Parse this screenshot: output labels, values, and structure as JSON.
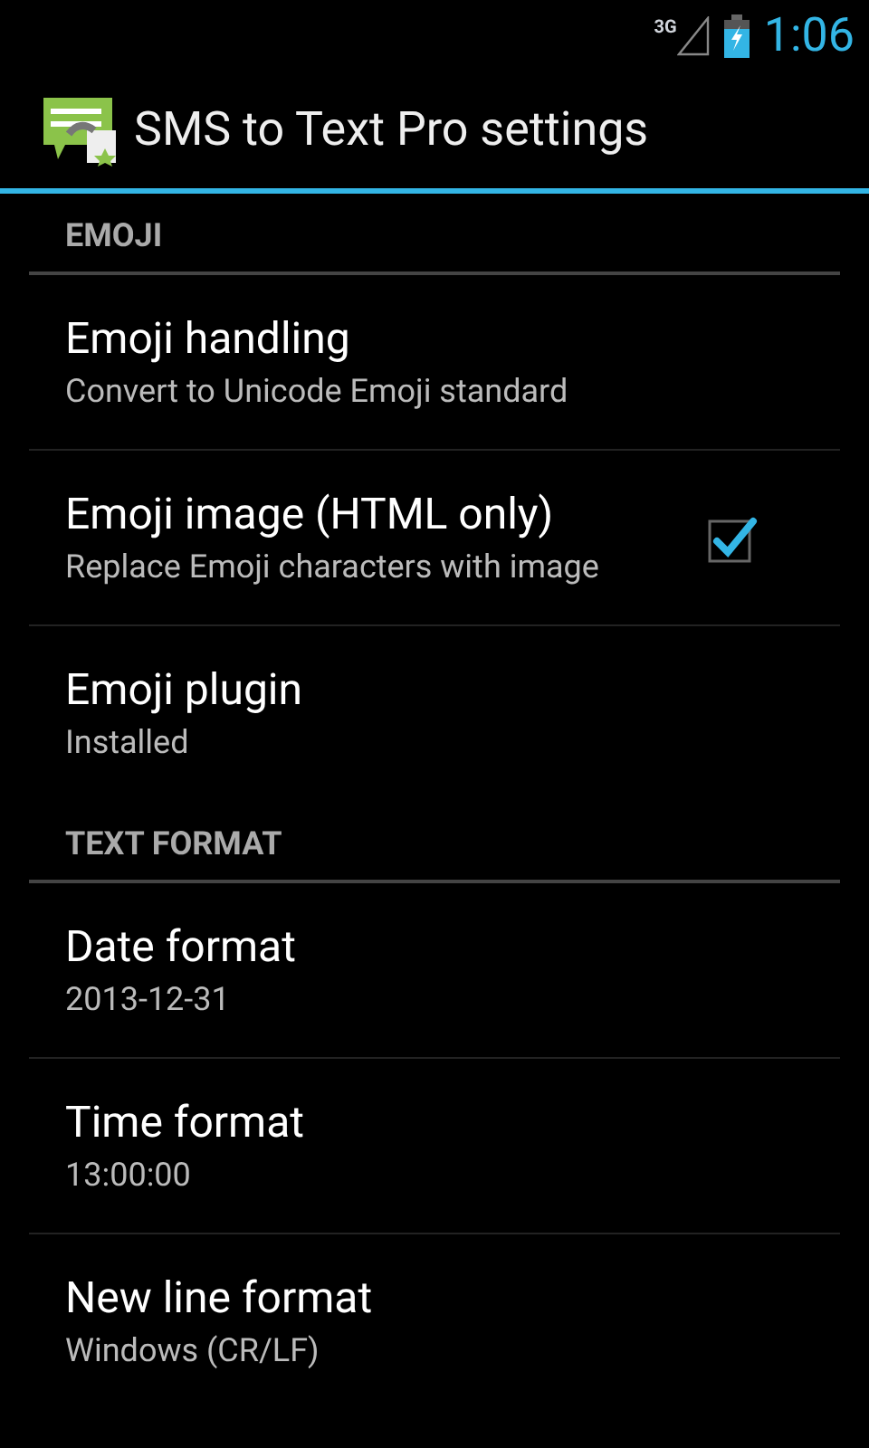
{
  "status_bar": {
    "network": "3G",
    "time": "1:06"
  },
  "action_bar": {
    "title": "SMS to Text Pro settings"
  },
  "sections": [
    {
      "header": "EMOJI",
      "items": [
        {
          "kind": "text",
          "title": "Emoji handling",
          "summary": "Convert to Unicode Emoji standard"
        },
        {
          "kind": "checkbox",
          "title": "Emoji image (HTML only)",
          "summary": "Replace Emoji characters with image",
          "checked": true
        },
        {
          "kind": "text",
          "title": "Emoji plugin",
          "summary": "Installed"
        }
      ]
    },
    {
      "header": "TEXT FORMAT",
      "items": [
        {
          "kind": "text",
          "title": "Date format",
          "summary": "2013-12-31"
        },
        {
          "kind": "text",
          "title": "Time format",
          "summary": "13:00:00"
        },
        {
          "kind": "text",
          "title": "New line format",
          "summary": "Windows (CR/LF)"
        }
      ]
    }
  ]
}
